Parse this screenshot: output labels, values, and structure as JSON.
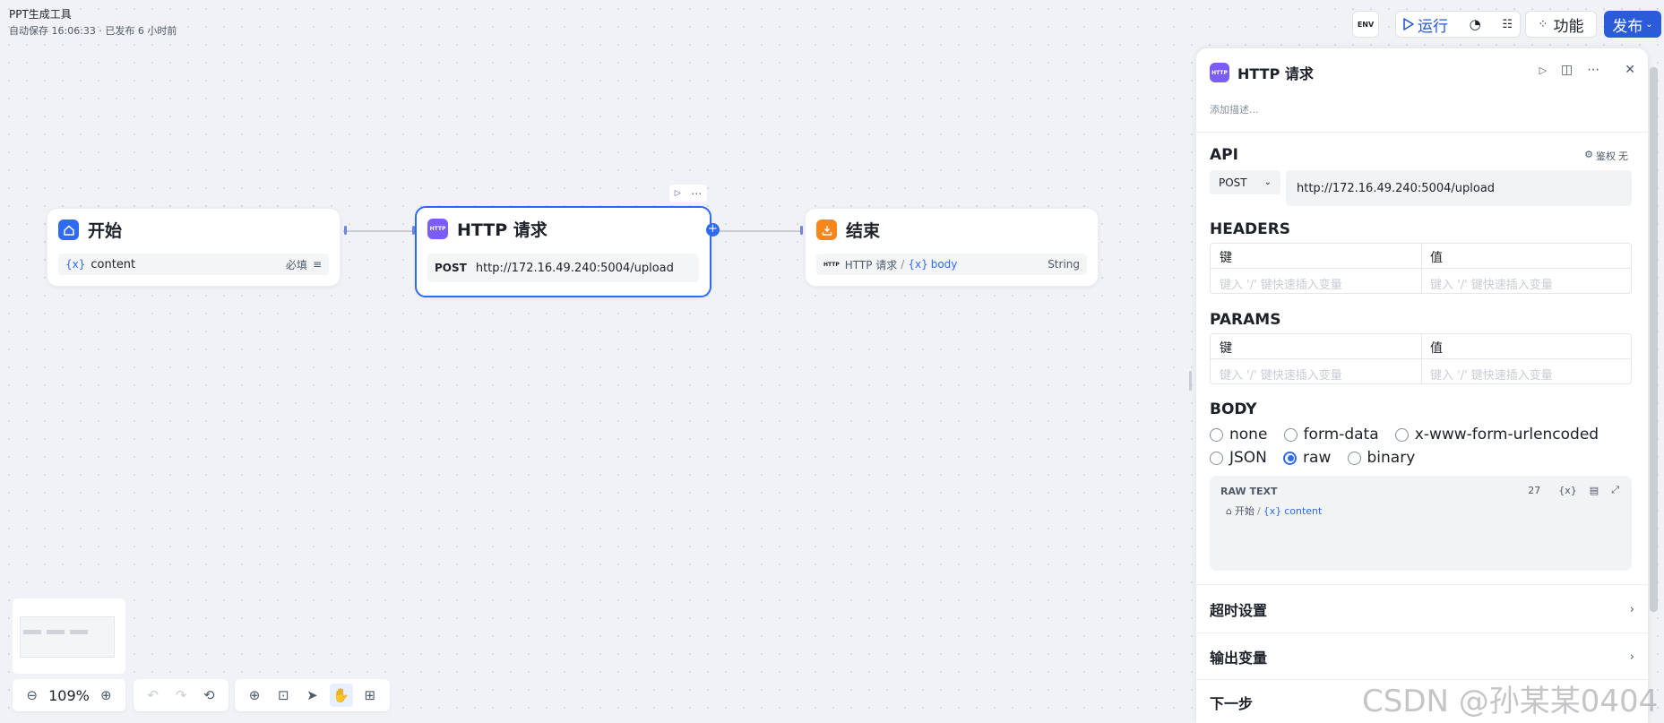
{
  "app": {
    "title": "PPT生成工具",
    "status": "自动保存 16:06:33 · 已发布 6 小时前"
  },
  "topbar": {
    "env": "ENV",
    "run": "运行",
    "function": "功能",
    "publish": "发布"
  },
  "nodes": {
    "start": {
      "title": "开始",
      "var_icon": "{x}",
      "var": "content",
      "required": "必填"
    },
    "http": {
      "title": "HTTP 请求",
      "icon_text": "HTTP",
      "method": "POST",
      "url": "http://172.16.49.240:5004/upload"
    },
    "end": {
      "title": "结束",
      "ref_icon": "HTTP",
      "ref_source": "HTTP 请求",
      "ref_sep": "/",
      "ref_var_icon": "{x}",
      "ref_var": "body",
      "type": "String"
    }
  },
  "panel": {
    "icon_text": "HTTP",
    "title": "HTTP 请求",
    "description_placeholder": "添加描述...",
    "api": {
      "label": "API",
      "auth_label": "鉴权",
      "auth_value": "无",
      "method": "POST",
      "url": "http://172.16.49.240:5004/upload"
    },
    "headers": {
      "label": "HEADERS",
      "key": "键",
      "value": "值",
      "key_placeholder": "键入 '/' 键快速插入变量",
      "value_placeholder": "键入 '/' 键快速插入变量"
    },
    "params": {
      "label": "PARAMS",
      "key": "键",
      "value": "值",
      "key_placeholder": "键入 '/' 键快速插入变量",
      "value_placeholder": "键入 '/' 键快速插入变量"
    },
    "body": {
      "label": "BODY",
      "options_row1": [
        "none",
        "form-data",
        "x-www-form-urlencoded"
      ],
      "options_row2": [
        "JSON",
        "raw",
        "binary"
      ],
      "selected": "raw",
      "raw_label": "RAW TEXT",
      "count": "27",
      "var_icon": "{x}",
      "ref_source": "开始",
      "ref_sep": "/",
      "ref_var_icon": "{x}",
      "ref_var": "content"
    },
    "timeout": "超时设置",
    "output": "输出变量",
    "next": "下一步"
  },
  "zoom": "109%",
  "watermark": "CSDN @孙某某0404",
  "colors": {
    "accent": "#2f6bf2",
    "start_icon": "#2f6bf2",
    "http_icon": "#7b5cf5",
    "end_icon": "#f7861d"
  }
}
